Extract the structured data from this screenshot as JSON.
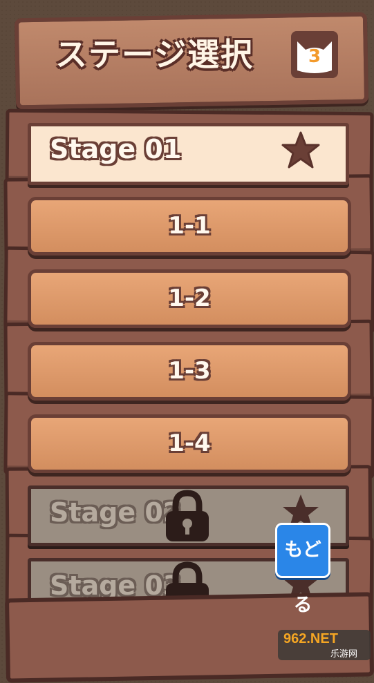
{
  "header": {
    "title": "ステージ選択",
    "cat_count": "3"
  },
  "stage_01": {
    "label": "Stage 01",
    "star_icon": "star-icon",
    "levels": [
      {
        "label": "1-1"
      },
      {
        "label": "1-2"
      },
      {
        "label": "1-3"
      },
      {
        "label": "1-4"
      }
    ]
  },
  "stage_02": {
    "label": "Stage 02",
    "locked": true
  },
  "stage_03": {
    "label": "Stage 03",
    "locked": true
  },
  "back_button": {
    "label": "もどる"
  },
  "watermark": {
    "main": "962.NET",
    "sub": "乐游网"
  },
  "colors": {
    "wood_dark": "#6a3f36",
    "plank": "#e8a677",
    "stage_header": "#fbe6cf",
    "back_button": "#2a86e8",
    "cat_count": "#f39a2b"
  }
}
